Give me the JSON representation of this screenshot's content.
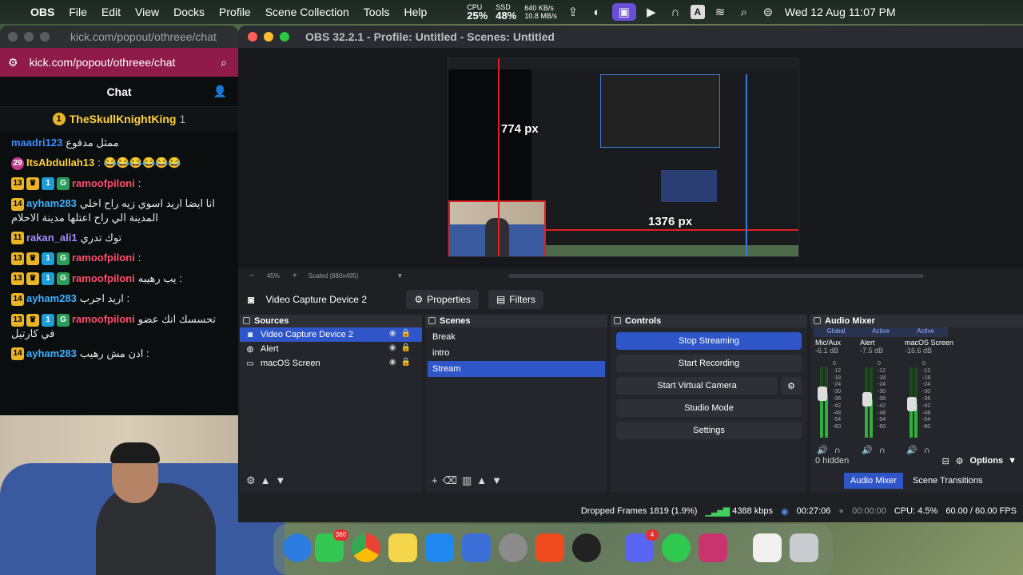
{
  "menubar": {
    "app": "OBS",
    "items": [
      "File",
      "Edit",
      "View",
      "Docks",
      "Profile",
      "Scene Collection",
      "Tools",
      "Help"
    ],
    "cpu_label": "CPU",
    "cpu_value": "25%",
    "ssd_label": "SSD",
    "ssd_value": "48%",
    "net_up": "640 KB/s",
    "net_down": "10.8 MB/s",
    "input_source": "A",
    "datetime": "Wed 12 Aug  11:07 PM"
  },
  "browser": {
    "title": "kick.com/popout/othreee/chat",
    "url": "kick.com/popout/othreee/chat",
    "chat_header": "Chat",
    "pinned_user": "TheSkullKnightKing",
    "pinned_count": "1",
    "messages": [
      {
        "user": "maadri123",
        "text": "ممثل مدفوع",
        "user_color": "#3f8cff",
        "badges": []
      },
      {
        "user": "ItsAbdullah13",
        "text": ": 😂😂😂😂😂😂",
        "user_color": "#ffd23a",
        "badges": [
          "29"
        ]
      },
      {
        "user": "ramoofpiloni",
        "text": ":",
        "user_color": "#ff4d6d",
        "badges": [
          "13",
          "♛",
          "1",
          "G"
        ]
      },
      {
        "user": "ayham283",
        "text": "انا ايضا اريد اسوي زيه راح اخلي المدينة الي راح اعتلها مدينة الاحلام",
        "user_color": "#3fb0ff",
        "badges": [
          "14"
        ]
      },
      {
        "user": "rakan_ali1",
        "text": "توك تدري",
        "user_color": "#a58bff",
        "badges": [
          "11"
        ]
      },
      {
        "user": "ramoofpiloni",
        "text": ":",
        "user_color": "#ff4d6d",
        "badges": [
          "13",
          "♛",
          "1",
          "G"
        ]
      },
      {
        "user": "ramoofpiloni",
        "text": "يب رهيبه :",
        "user_color": "#ff4d6d",
        "badges": [
          "13",
          "♛",
          "1",
          "G"
        ]
      },
      {
        "user": "ayham283",
        "text": "اريد اجرب :",
        "user_color": "#3fb0ff",
        "badges": [
          "14"
        ]
      },
      {
        "user": "ramoofpiloni",
        "text": "تحسسك انك عضو في كارتيل",
        "user_color": "#ff4d6d",
        "badges": [
          "13",
          "♛",
          "1",
          "G"
        ]
      },
      {
        "user": "ayham283",
        "text": "ادن مش رهيب :",
        "user_color": "#3fb0ff",
        "badges": [
          "14"
        ]
      }
    ]
  },
  "obs": {
    "title": "OBS 32.2.1 - Profile: Untitled - Scenes: Untitled",
    "preview": {
      "measure_h": "774 px",
      "measure_w": "1376 px",
      "zoom": "45%",
      "scaled": "Scaled (880x495)"
    },
    "selected_source": "Video Capture Device 2",
    "properties_label": "Properties",
    "filters_label": "Filters",
    "sources": {
      "title": "Sources",
      "items": [
        {
          "name": "Video Capture Device 2",
          "icon": "camera-icon",
          "selected": true
        },
        {
          "name": "Alert",
          "icon": "globe-icon",
          "selected": false
        },
        {
          "name": "macOS Screen",
          "icon": "monitor-icon",
          "selected": false
        }
      ]
    },
    "scenes": {
      "title": "Scenes",
      "items": [
        {
          "name": "Break",
          "selected": false
        },
        {
          "name": "intro",
          "selected": false
        },
        {
          "name": "Stream",
          "selected": true
        }
      ]
    },
    "controls": {
      "title": "Controls",
      "stop_streaming": "Stop Streaming",
      "start_recording": "Start Recording",
      "start_virtual_camera": "Start Virtual Camera",
      "studio_mode": "Studio Mode",
      "settings": "Settings"
    },
    "mixer": {
      "title": "Audio Mixer",
      "channels": [
        {
          "tag": "Global",
          "name": "Mic/Aux",
          "db": "-6.1 dB",
          "level": 0.62
        },
        {
          "tag": "Active",
          "name": "Alert",
          "db": "-7.5 dB",
          "level": 0.55
        },
        {
          "tag": "Active",
          "name": "macOS Screen",
          "db": "-16.6 dB",
          "level": 0.48
        }
      ],
      "scale": [
        "0",
        "-12",
        "-18",
        "-24",
        "-30",
        "-36",
        "-42",
        "-48",
        "-54",
        "-60"
      ],
      "hidden": "0 hidden",
      "options": "Options",
      "tab_mixer": "Audio Mixer",
      "tab_transitions": "Scene Transitions"
    },
    "status": {
      "dropped": "Dropped Frames 1819 (1.9%)",
      "kbps": "4388 kbps",
      "stream_time": "00:27:06",
      "rec_time": "00:00:00",
      "cpu": "CPU: 4.5%",
      "fps": "60.00 / 60.00 FPS"
    }
  },
  "dock": {
    "messages_badge": "360",
    "discord_badge": "4"
  }
}
